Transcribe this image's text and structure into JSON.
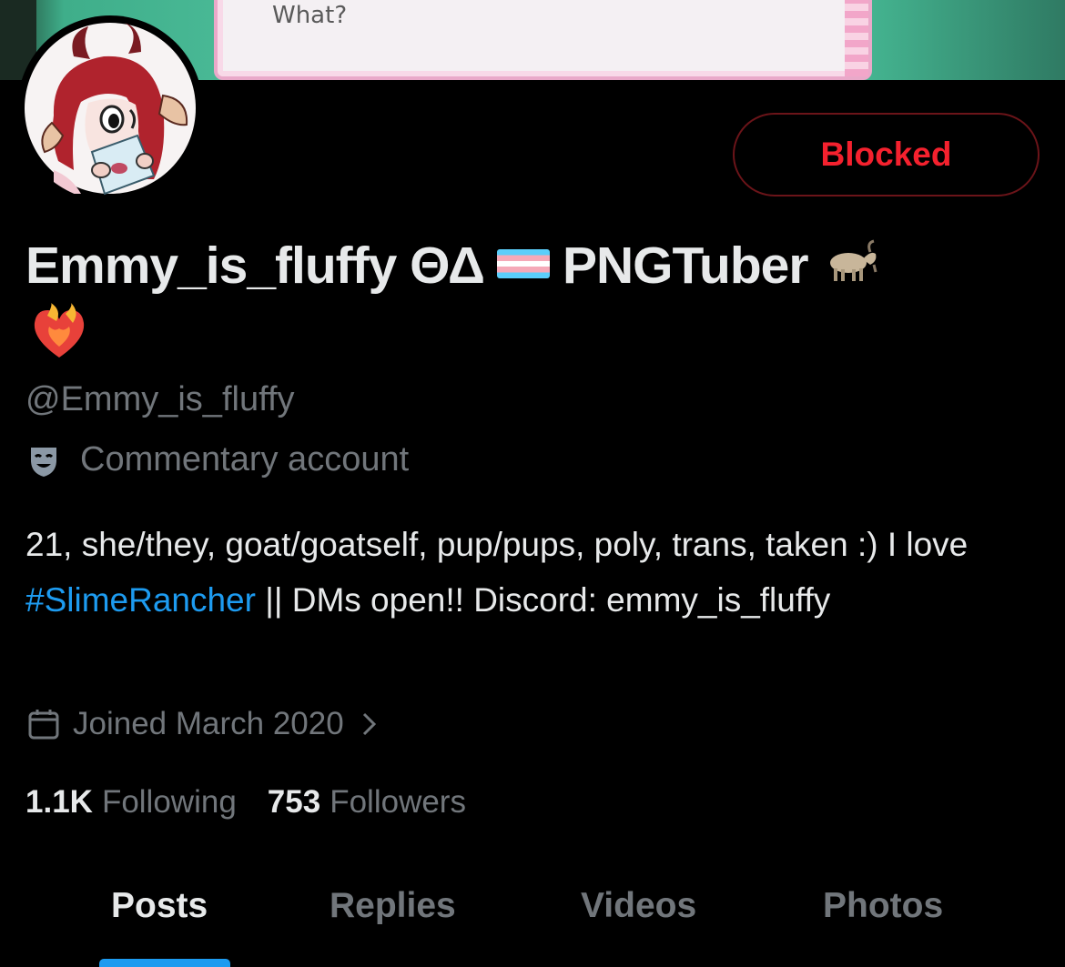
{
  "banner": {
    "dialog_text": "What?"
  },
  "profile": {
    "blocked_label": "Blocked",
    "name_main": "Emmy_is_fluffy ΘΔ",
    "name_suffix": "PNGTuber",
    "handle": "@Emmy_is_fluffy",
    "account_label": "Commentary account",
    "bio": {
      "before_hashtag": "21, she/they, goat/goatself, pup/pups, poly, trans, taken :) I love ",
      "hashtag": "#SlimeRancher",
      "after_hashtag": " || DMs open!! Discord: emmy_is_fluffy"
    },
    "joined": "Joined March 2020",
    "following_count": "1.1K",
    "following_label": "Following",
    "followers_count": "753",
    "followers_label": "Followers"
  },
  "tabs": [
    {
      "label": "Posts",
      "active": true
    },
    {
      "label": "Replies",
      "active": false
    },
    {
      "label": "Videos",
      "active": false
    },
    {
      "label": "Photos",
      "active": false
    }
  ],
  "icons": {
    "flag": "transgender-flag-emoji",
    "goat": "goat-emoji",
    "heart": "heart-on-fire-emoji",
    "label": "performing-arts-mask-icon",
    "calendar": "calendar-icon",
    "chevron": "chevron-right-icon"
  },
  "colors": {
    "background": "#000000",
    "text_primary": "#e7e9ea",
    "text_secondary": "#71767b",
    "accent": "#1d9bf0",
    "blocked": "#f4212e"
  }
}
